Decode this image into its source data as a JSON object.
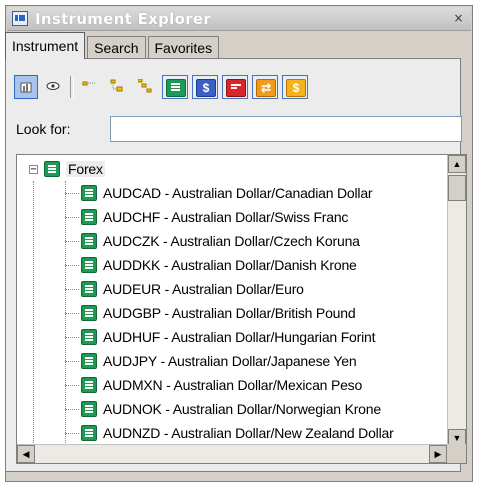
{
  "window": {
    "title": "Instrument Explorer",
    "close_glyph": "×"
  },
  "tabs": [
    {
      "label": "Instrument",
      "active": true
    },
    {
      "label": "Search",
      "active": false
    },
    {
      "label": "Favorites",
      "active": false
    }
  ],
  "toolbar": {
    "icons": [
      "chart-icon",
      "eye-icon",
      "tree-level-1-icon",
      "tree-level-2-icon",
      "tree-level-3-icon",
      "forex-green-icon",
      "blue-dollar-icon",
      "red-note-icon",
      "orange-link-icon",
      "orange-bill-icon"
    ],
    "glyphs": {
      "blue": "$",
      "orange1": "⇄",
      "orange2": "$"
    }
  },
  "search": {
    "label": "Look for:",
    "value": "",
    "placeholder": ""
  },
  "tree": {
    "root": {
      "label": "Forex",
      "expander": "−"
    },
    "items": [
      "AUDCAD - Australian Dollar/Canadian Dollar",
      "AUDCHF - Australian Dollar/Swiss Franc",
      "AUDCZK - Australian Dollar/Czech Koruna",
      "AUDDKK - Australian Dollar/Danish Krone",
      "AUDEUR - Australian Dollar/Euro",
      "AUDGBP - Australian Dollar/British Pound",
      "AUDHUF - Australian Dollar/Hungarian Forint",
      "AUDJPY - Australian Dollar/Japanese Yen",
      "AUDMXN - Australian Dollar/Mexican Peso",
      "AUDNOK - Australian Dollar/Norwegian Krone",
      "AUDNZD - Australian Dollar/New Zealand Dollar"
    ]
  },
  "scroll": {
    "up": "▲",
    "down": "▼",
    "left": "◀",
    "right": "▶"
  },
  "colors": {
    "forex_icon": "#1f9a55",
    "selected_toolbar": "#a8c4ee",
    "chrome": "#d4d0c8"
  }
}
